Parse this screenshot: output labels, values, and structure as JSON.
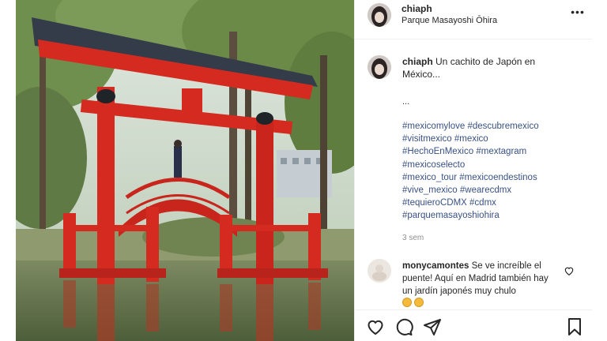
{
  "post": {
    "username": "chiaph",
    "location": "Parque Masayoshi Ōhira",
    "more_icon": "more-horizontal-icon"
  },
  "caption": {
    "username": "chiaph",
    "text": "Un cachito de Japón en México...",
    "ellipsis": "...",
    "hashtags": [
      [
        "#mexicomylove",
        "#descubremexico"
      ],
      [
        "#visitmexico",
        "#mexico"
      ],
      [
        "#HechoEnMexico",
        "#mextagram"
      ],
      [
        "#mexicoselecto"
      ],
      [
        "#mexico_tour",
        "#mexicoendestinos"
      ],
      [
        "#vive_mexico",
        "#wearecdmx"
      ],
      [
        "#tequieroCDMX",
        "#cdmx"
      ],
      [
        "#parquemasayoshiohira"
      ]
    ],
    "time": "3 sem"
  },
  "comment": {
    "username": "monycamontes",
    "text": "Se ve increíble el puente! Aquí en Madrid también hay un jardín japonés muy chulo"
  },
  "actions": {
    "like_icon": "heart-icon",
    "comment_icon": "comment-icon",
    "share_icon": "send-icon",
    "save_icon": "bookmark-icon"
  },
  "colors": {
    "hashtag": "#385185",
    "muted": "#8e8e8e",
    "torii_red": "#d42a20"
  }
}
